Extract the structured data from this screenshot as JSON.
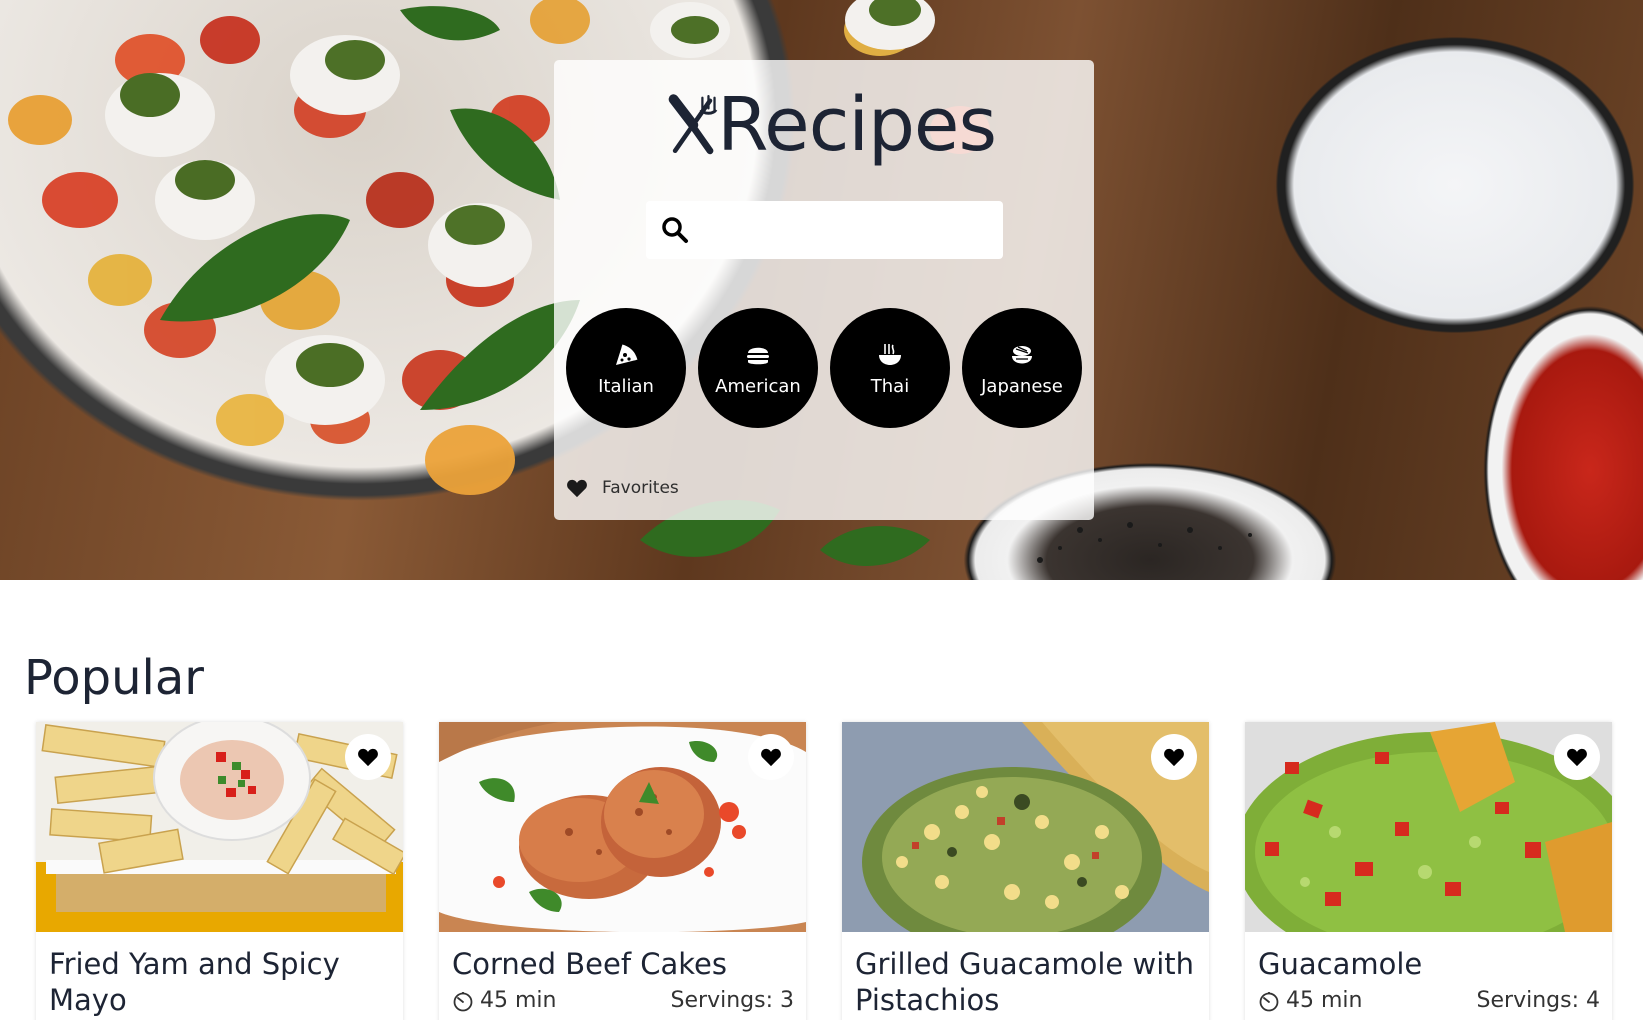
{
  "app": {
    "title": "Recipes"
  },
  "search": {
    "value": "",
    "placeholder": ""
  },
  "cuisines": [
    {
      "label": "Italian",
      "icon": "pizza-icon"
    },
    {
      "label": "American",
      "icon": "burger-icon"
    },
    {
      "label": "Thai",
      "icon": "noodle-bowl-icon"
    },
    {
      "label": "Japanese",
      "icon": "sushi-icon"
    }
  ],
  "favorites": {
    "label": "Favorites",
    "icon": "heart-icon"
  },
  "popular": {
    "title": "Popular",
    "recipes": [
      {
        "title": "Fried Yam and Spicy Mayo",
        "time": "",
        "servings": ""
      },
      {
        "title": "Corned Beef Cakes",
        "time": "45 min",
        "servings": "Servings: 3"
      },
      {
        "title": "Grilled Guacamole with Pistachios",
        "time": "",
        "servings": ""
      },
      {
        "title": "Guacamole",
        "time": "45 min",
        "servings": "Servings: 4"
      }
    ]
  },
  "colors": {
    "text_dark": "#1d2434",
    "cuisine_bg": "#000000",
    "panel_bg": "rgba(255,255,255,0.80)"
  }
}
